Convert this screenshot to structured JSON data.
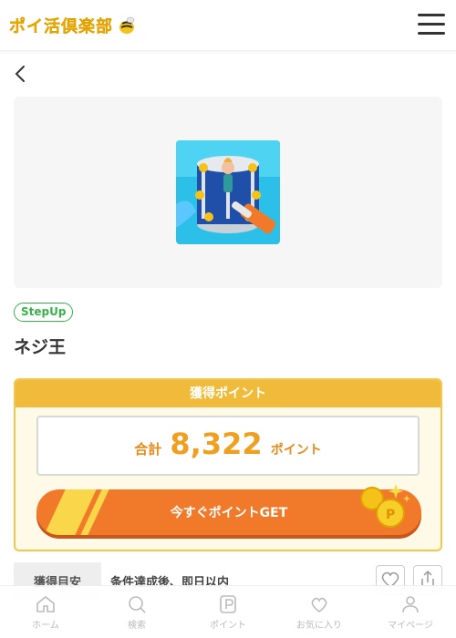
{
  "header": {
    "logo_text": "ポイ活倶楽部",
    "menu_icon": "hamburger-menu-icon"
  },
  "nav": {
    "back_icon": "chevron-left-icon"
  },
  "offer": {
    "tag": "StepUp",
    "title": "ネジ王",
    "app_icon": "app-icon-image"
  },
  "points": {
    "header": "獲得ポイント",
    "total_label": "合計",
    "total_value": "8,322",
    "total_unit": "ポイント",
    "get_button": "今すぐポイントGET"
  },
  "estimate": {
    "label": "獲得目安",
    "value": "条件達成後、即日以内"
  },
  "actions": {
    "favorite_icon": "heart-icon",
    "share_icon": "share-icon"
  },
  "tabbar": {
    "items": [
      {
        "label": "ホーム",
        "icon": "home-icon"
      },
      {
        "label": "検索",
        "icon": "search-icon"
      },
      {
        "label": "ポイント",
        "icon": "point-icon"
      },
      {
        "label": "お気に入り",
        "icon": "heart-icon"
      },
      {
        "label": "マイページ",
        "icon": "user-icon"
      }
    ]
  },
  "colors": {
    "accent_orange": "#f07a2a",
    "gold": "#f0bb3a",
    "green": "#38b24a"
  }
}
